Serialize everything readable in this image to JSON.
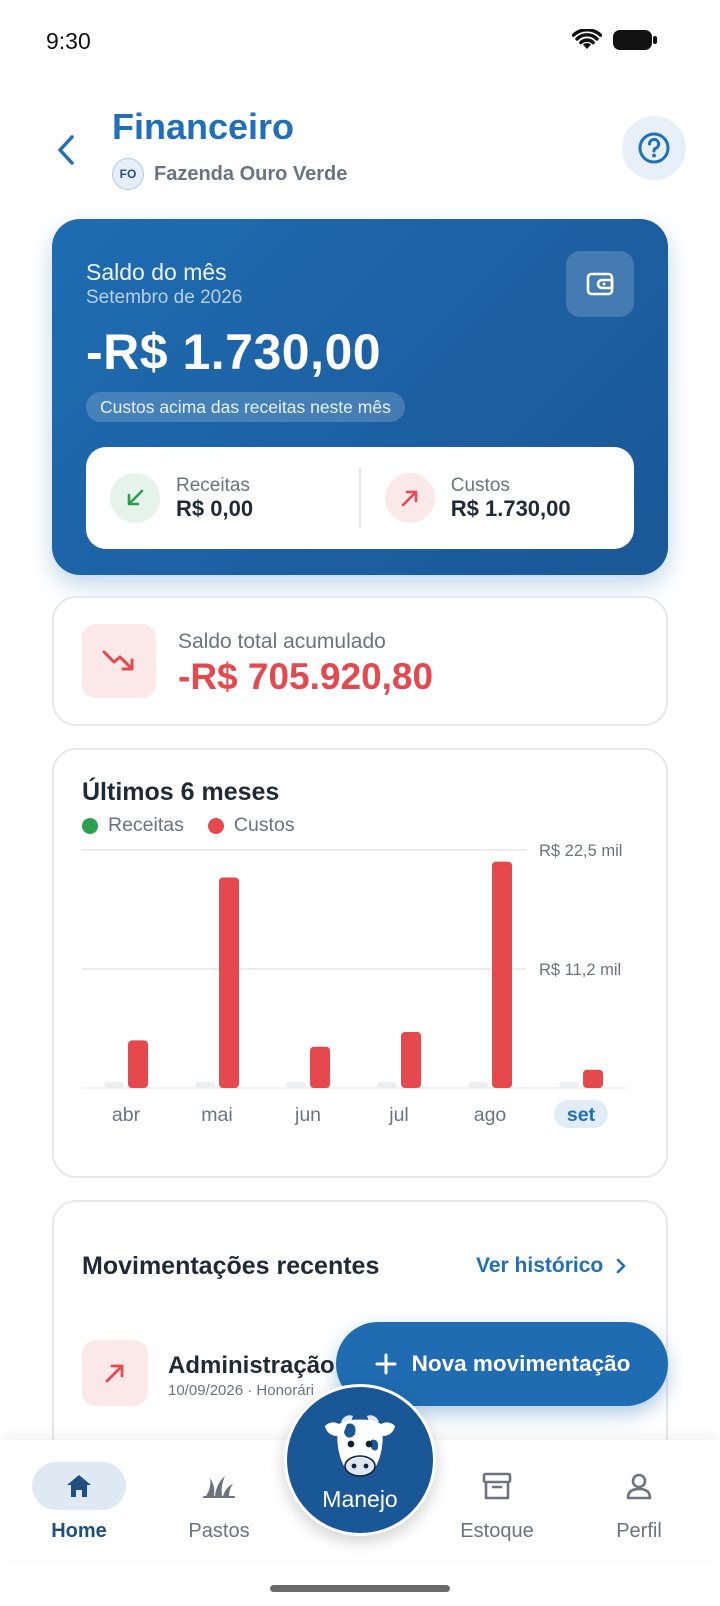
{
  "status_bar": {
    "time": "9:30"
  },
  "header": {
    "title": "Financeiro",
    "farm_initials": "FO",
    "farm_name": "Fazenda Ouro Verde"
  },
  "balance": {
    "label": "Saldo do mês",
    "period": "Setembro de 2026",
    "amount": "-R$ 1.730,00",
    "note": "Custos acima das receitas neste mês",
    "income_label": "Receitas",
    "income_value": "R$ 0,00",
    "cost_label": "Custos",
    "cost_value": "R$ 1.730,00"
  },
  "accumulated": {
    "label": "Saldo total acumulado",
    "value": "-R$ 705.920,80"
  },
  "chart_data": {
    "type": "bar",
    "title": "Últimos 6 meses",
    "categories": [
      "abr",
      "mai",
      "jun",
      "jul",
      "ago",
      "set"
    ],
    "selected_category": "set",
    "series": [
      {
        "name": "Receitas",
        "color": "#2e9e4f",
        "values": [
          0,
          0,
          0,
          0,
          0,
          0
        ]
      },
      {
        "name": "Custos",
        "color": "#e5484d",
        "values": [
          4500,
          19900,
          3900,
          5300,
          21400,
          1730
        ]
      }
    ],
    "y_ticks": [
      {
        "value": 11250,
        "label": "R$ 11,2 mil"
      },
      {
        "value": 22500,
        "label": "R$ 22,5 mil"
      }
    ],
    "ylim": [
      0,
      22500
    ],
    "grid": true,
    "legend": "top-left"
  },
  "recent": {
    "title": "Movimentações recentes",
    "link": "Ver histórico",
    "items": [
      {
        "title": "Administração",
        "subtitle": "10/09/2026 · Honorári"
      }
    ]
  },
  "fab": {
    "label": "Nova movimentação"
  },
  "nav": {
    "home": "Home",
    "pastos": "Pastos",
    "manejo": "Manejo",
    "estoque": "Estoque",
    "perfil": "Perfil"
  },
  "colors": {
    "primary": "#1f6cb2",
    "negative": "#e5484d",
    "positive": "#2e9e4f"
  }
}
